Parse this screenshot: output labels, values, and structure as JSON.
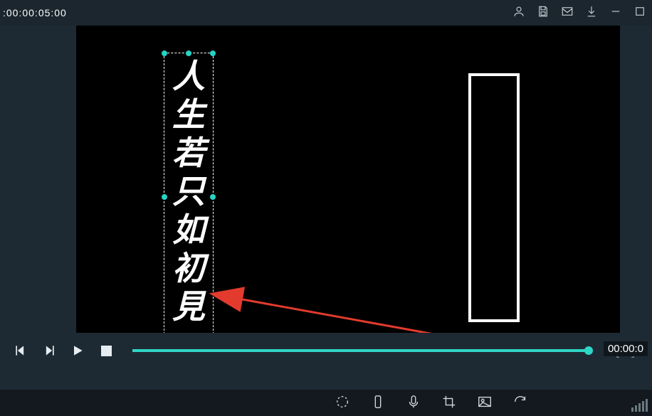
{
  "header": {
    "timecode": ":00:00:05:00"
  },
  "canvas": {
    "vertical_text_chars": [
      "人",
      "生",
      "若",
      "只",
      "如",
      "初",
      "見"
    ]
  },
  "playback": {
    "time_right": "00:00:0",
    "bracket_marks": "[   ]"
  }
}
